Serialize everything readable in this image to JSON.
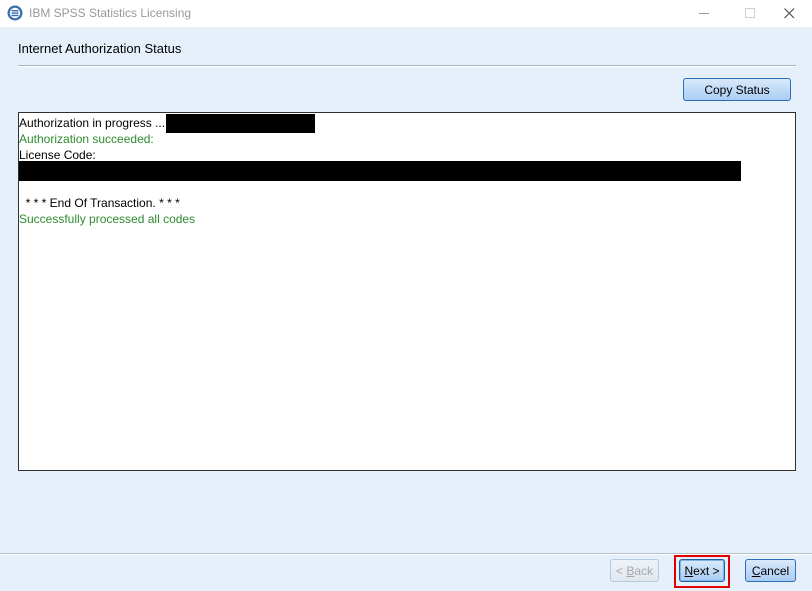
{
  "window": {
    "title": "IBM SPSS Statistics Licensing",
    "minimize_label": "minimize",
    "maximize_label": "maximize",
    "close_label": "close"
  },
  "header": {
    "title": "Internet Authorization Status"
  },
  "toolbar": {
    "copy_status_label": "Copy Status"
  },
  "status_log": {
    "lines": [
      {
        "text": "Authorization in progress ...",
        "color": "#000000"
      },
      {
        "text": "Authorization succeeded:",
        "color": "#2e8b2e"
      },
      {
        "text": "License Code:",
        "color": "#000000"
      },
      {
        "text": "  * * * End Of Transaction. * * *",
        "color": "#000000"
      },
      {
        "text": "Successfully processed all codes",
        "color": "#2e8b2e"
      }
    ]
  },
  "footer": {
    "back_mnemonic": "B",
    "back_rest": "ack",
    "back_prefix": "< ",
    "next_mnemonic": "N",
    "next_rest": "ext >",
    "cancel_mnemonic": "C",
    "cancel_rest": "ancel"
  },
  "colors": {
    "accent_border": "#2b6fb8",
    "success_text": "#2e8b2e",
    "highlight": "#e00000",
    "background": "#e6f0fa"
  }
}
